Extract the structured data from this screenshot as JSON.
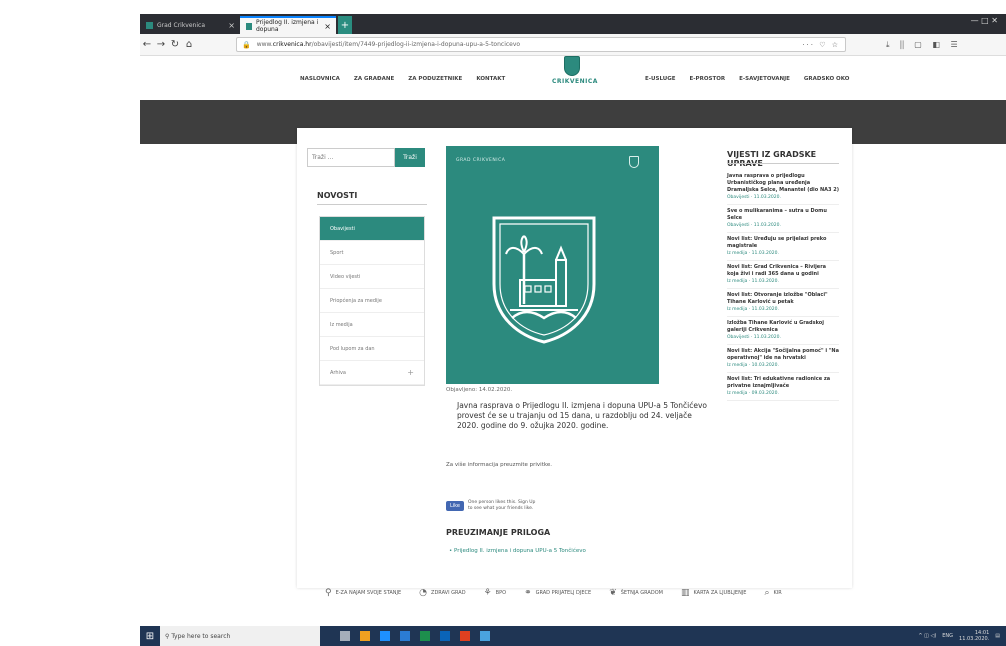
{
  "browser": {
    "tabs": [
      {
        "label": "Grad Crikvenica"
      },
      {
        "label": "Prijedlog II. izmjena i dopuna"
      }
    ],
    "new_tab": "+",
    "window_controls": "— □ ✕",
    "url": {
      "prefix": "www.",
      "domain": "crikvenica.hr",
      "path": "/obavijesti/item/7449-prijedlog-ii-izmjena-i-dopuna-upu-a-5-toncicevo"
    },
    "url_actions": "··· ♡ ☆",
    "toolbar_icons": "⤓ ⫼ ▢ ◧ ☰"
  },
  "site": {
    "nav_left": [
      "NASLOVNICA",
      "ZA GRAĐANE",
      "ZA PODUZETNIKE",
      "KONTAKT"
    ],
    "nav_right": [
      "E-USLUGE",
      "E-PROSTOR",
      "E-SAVJETOVANJE",
      "GRADSKO OKO"
    ],
    "logo_text": "CRIKVENICA",
    "colors": {
      "brand": "#2c8a7e",
      "banner": "#3e3e3e"
    }
  },
  "sidebar": {
    "search_placeholder": "Traži ...",
    "search_button": "Traži",
    "heading": "NOVOSTI",
    "items": [
      {
        "label": "Obavijesti"
      },
      {
        "label": "Sport"
      },
      {
        "label": "Video vijesti"
      },
      {
        "label": "Priopćenja za medije"
      },
      {
        "label": "Iz medija"
      },
      {
        "label": "Pod lupom za dan"
      },
      {
        "label": "Arhiva",
        "suffix": "+"
      }
    ]
  },
  "article": {
    "hero_top_text": "GRAD CRIKVENICA",
    "published": "Objavljeno: 14.02.2020.",
    "lead": "Javna rasprava o Prijedlogu II. izmjena i dopuna UPU-a 5 Tončićevo provest će se u trajanju od 15 dana, u razdoblju od 24. veljače 2020. godine do 9. ožujka 2020. godine.",
    "info": "Za više informacija preuzmite privitke.",
    "fb_like": "Like",
    "fb_text": "One person likes this. Sign Up to see what your friends like.",
    "attachments_heading": "PREUZIMANJE PRILOGA",
    "attachment_link": "• Prijedlog II. izmjena i dopuna UPU-a 5 Tončićevo"
  },
  "news": {
    "heading": "VIJESTI IZ GRADSKE UPRAVE",
    "items": [
      {
        "title": "Javna rasprava o prijedlogu Urbanističkog plana uređenja Dramaljska Selce, Manantel (dio NA3 2)",
        "meta": "Obavijesti · 11.03.2020."
      },
      {
        "title": "Sve o mulikaranima – sutra u Domu Selce",
        "meta": "Obavijesti · 11.03.2020."
      },
      {
        "title": "Novi list: Uređuju se prijelazi preko magistrale",
        "meta": "Iz medija · 11.03.2020."
      },
      {
        "title": "Novi list: Grad Crikvenica – Rivijera koja živi i radi 365 dana u godini",
        "meta": "Iz medija · 11.03.2020."
      },
      {
        "title": "Novi list: Otvoranje izložbe \"Oblaci\" Tihane Karlović u petak",
        "meta": "Iz medija · 11.03.2020."
      },
      {
        "title": "Izložba Tihane Karlović u Gradskoj galeriji Crikvenica",
        "meta": "Obavijesti · 11.03.2020."
      },
      {
        "title": "Novi list: Akcija \"Sočijalna pomoć\" i \"Na operativnoj\" ide na hrvatski",
        "meta": "Iz medija · 10.03.2020."
      },
      {
        "title": "Novi list: Tri edukativne radionice za privatne iznajmljivače",
        "meta": "Iz medija · 09.03.2020."
      }
    ]
  },
  "footer": {
    "links": [
      {
        "icon": "⚲",
        "label": "E-ZA NAJAM SVOJE STANJE"
      },
      {
        "icon": "◔",
        "label": "ZDRAVI GRAD"
      },
      {
        "icon": "⚘",
        "label": "BPO"
      },
      {
        "icon": "⚭",
        "label": "GRAD PRIJATELJ DJECE"
      },
      {
        "icon": "❦",
        "label": "ŠETNJA GRADOM"
      },
      {
        "icon": "▥",
        "label": "KARTA ZA LJUBLJENJE"
      },
      {
        "icon": "⌕",
        "label": "KIR"
      }
    ]
  },
  "taskbar": {
    "search_placeholder": "Type here to search",
    "tray_text": "ENG",
    "time": "14:01",
    "date": "11.03.2020."
  }
}
